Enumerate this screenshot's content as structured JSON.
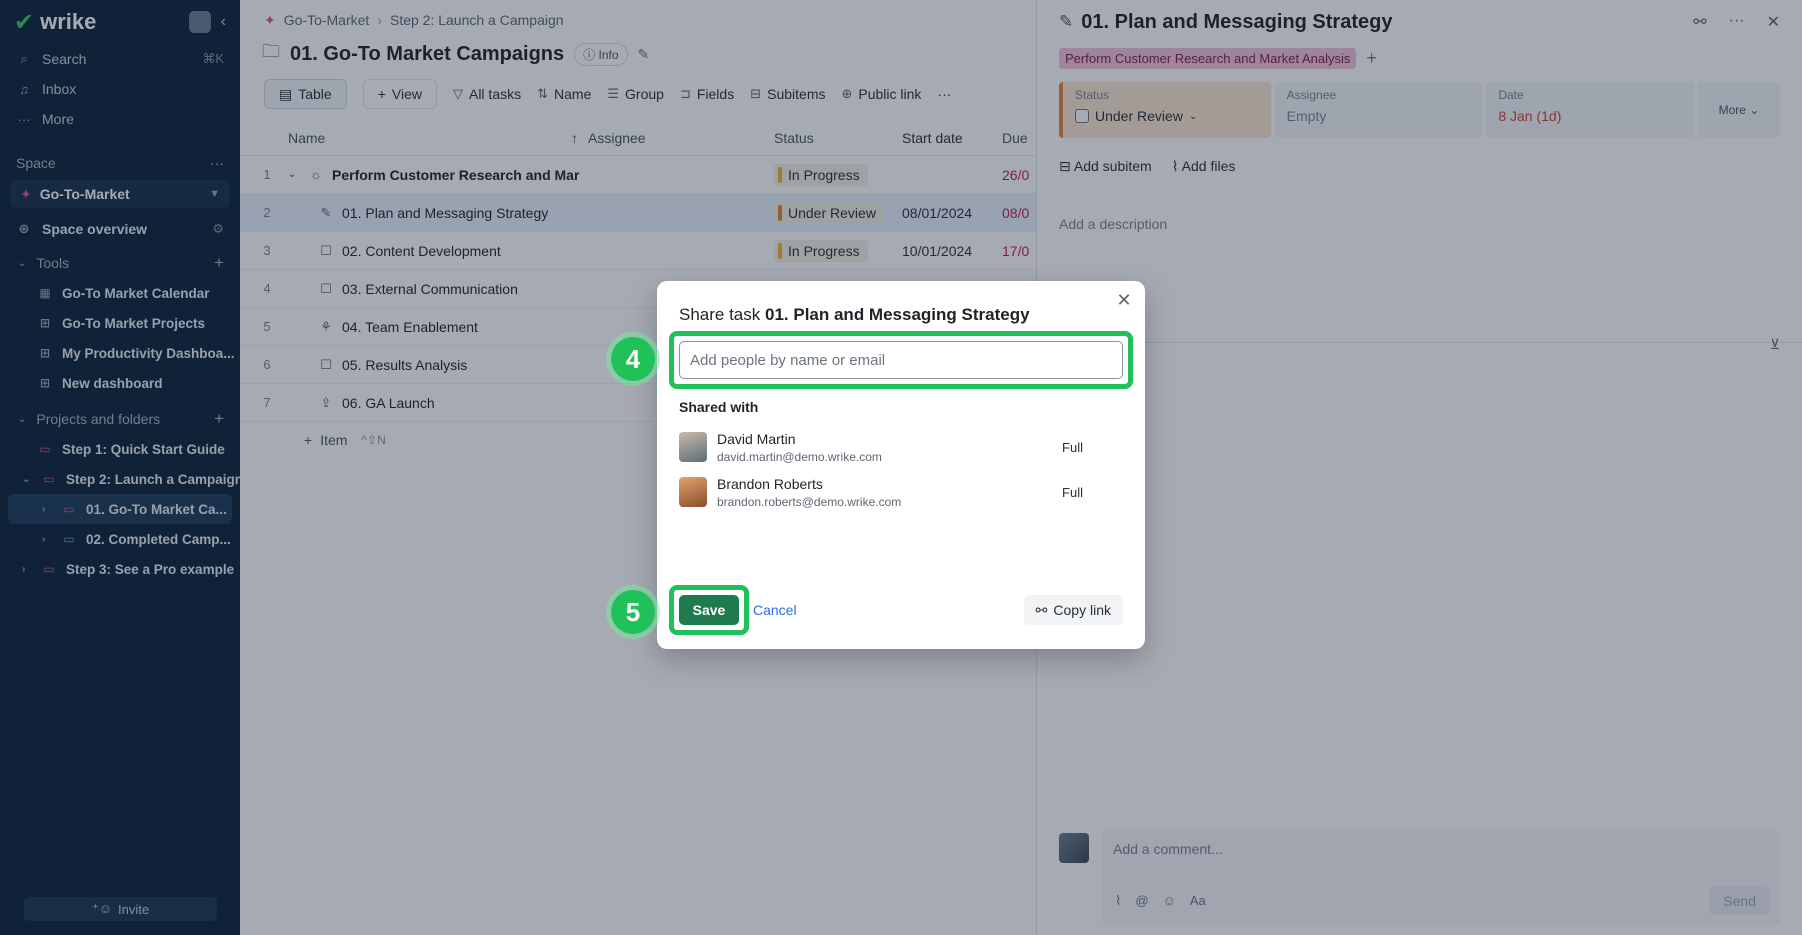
{
  "sidebar": {
    "logo": "wrike",
    "search": "Search",
    "search_kbd": "⌘K",
    "inbox": "Inbox",
    "more": "More",
    "space_label": "Space",
    "space_name": "Go-To-Market",
    "space_overview": "Space overview",
    "tools_label": "Tools",
    "tools": [
      "Go-To Market Calendar",
      "Go-To Market Projects",
      "My Productivity Dashboa...",
      "New dashboard"
    ],
    "projects_label": "Projects and folders",
    "folders": [
      "Step 1: Quick Start Guide",
      "Step 2: Launch a Campaign",
      "01. Go-To Market Ca...",
      "02. Completed Camp...",
      "Step 3: See a Pro example"
    ],
    "invite": "Invite"
  },
  "main": {
    "breadcrumb": [
      "Go-To-Market",
      "Step 2: Launch a Campaign"
    ],
    "title": "01. Go-To Market Campaigns",
    "info": "Info",
    "toolbar": {
      "table": "Table",
      "view": "View",
      "all_tasks": "All tasks",
      "name": "Name",
      "group": "Group",
      "fields": "Fields",
      "subitems": "Subitems",
      "public_link": "Public link"
    },
    "columns": {
      "name": "Name",
      "assignee": "Assignee",
      "status": "Status",
      "start": "Start date",
      "due": "Due"
    },
    "rows": [
      {
        "num": "1",
        "name": "Perform Customer Research and Mar",
        "status": "In Progress",
        "start": "",
        "due": "26/0"
      },
      {
        "num": "2",
        "name": "01. Plan and Messaging Strategy",
        "status": "Under Review",
        "start": "08/01/2024",
        "due": "08/0"
      },
      {
        "num": "3",
        "name": "02. Content Development",
        "status": "In Progress",
        "start": "10/01/2024",
        "due": "17/0"
      },
      {
        "num": "4",
        "name": "03. External Communication",
        "status": "",
        "start": "",
        "due": ""
      },
      {
        "num": "5",
        "name": "04. Team Enablement",
        "status": "",
        "start": "",
        "due": ""
      },
      {
        "num": "6",
        "name": "05. Results Analysis",
        "status": "",
        "start": "",
        "due": ""
      },
      {
        "num": "7",
        "name": "06. GA Launch",
        "status": "",
        "start": "",
        "due": ""
      }
    ],
    "add_item": "Item",
    "add_item_kbd": "^⇧N",
    "status_colors": {
      "in_progress": "#f0b429",
      "under_review": "#e3843b"
    }
  },
  "panel": {
    "title": "01. Plan and Messaging Strategy",
    "parent_tag": "Perform Customer Research and Market Analysis",
    "status_label": "Status",
    "status_value": "Under Review",
    "assignee_label": "Assignee",
    "assignee_value": "Empty",
    "date_label": "Date",
    "date_value": "8 Jan (1d)",
    "more": "More",
    "add_subitem": "Add subitem",
    "add_files": "Add files",
    "description_placeholder": "Add a description",
    "comment_placeholder": "Add a comment...",
    "send": "Send",
    "format": "Aa"
  },
  "modal": {
    "title_prefix": "Share task",
    "title_task": "01. Plan and Messaging Strategy",
    "input_placeholder": "Add people by name or email",
    "shared_with": "Shared with",
    "people": [
      {
        "name": "David Martin",
        "email": "david.martin@demo.wrike.com",
        "permission": "Full"
      },
      {
        "name": "Brandon Roberts",
        "email": "brandon.roberts@demo.wrike.com",
        "permission": "Full"
      }
    ],
    "save": "Save",
    "cancel": "Cancel",
    "copy_link": "Copy link"
  },
  "steps": {
    "input_step": "4",
    "save_step": "5",
    "highlight_color": "#21c15a"
  }
}
